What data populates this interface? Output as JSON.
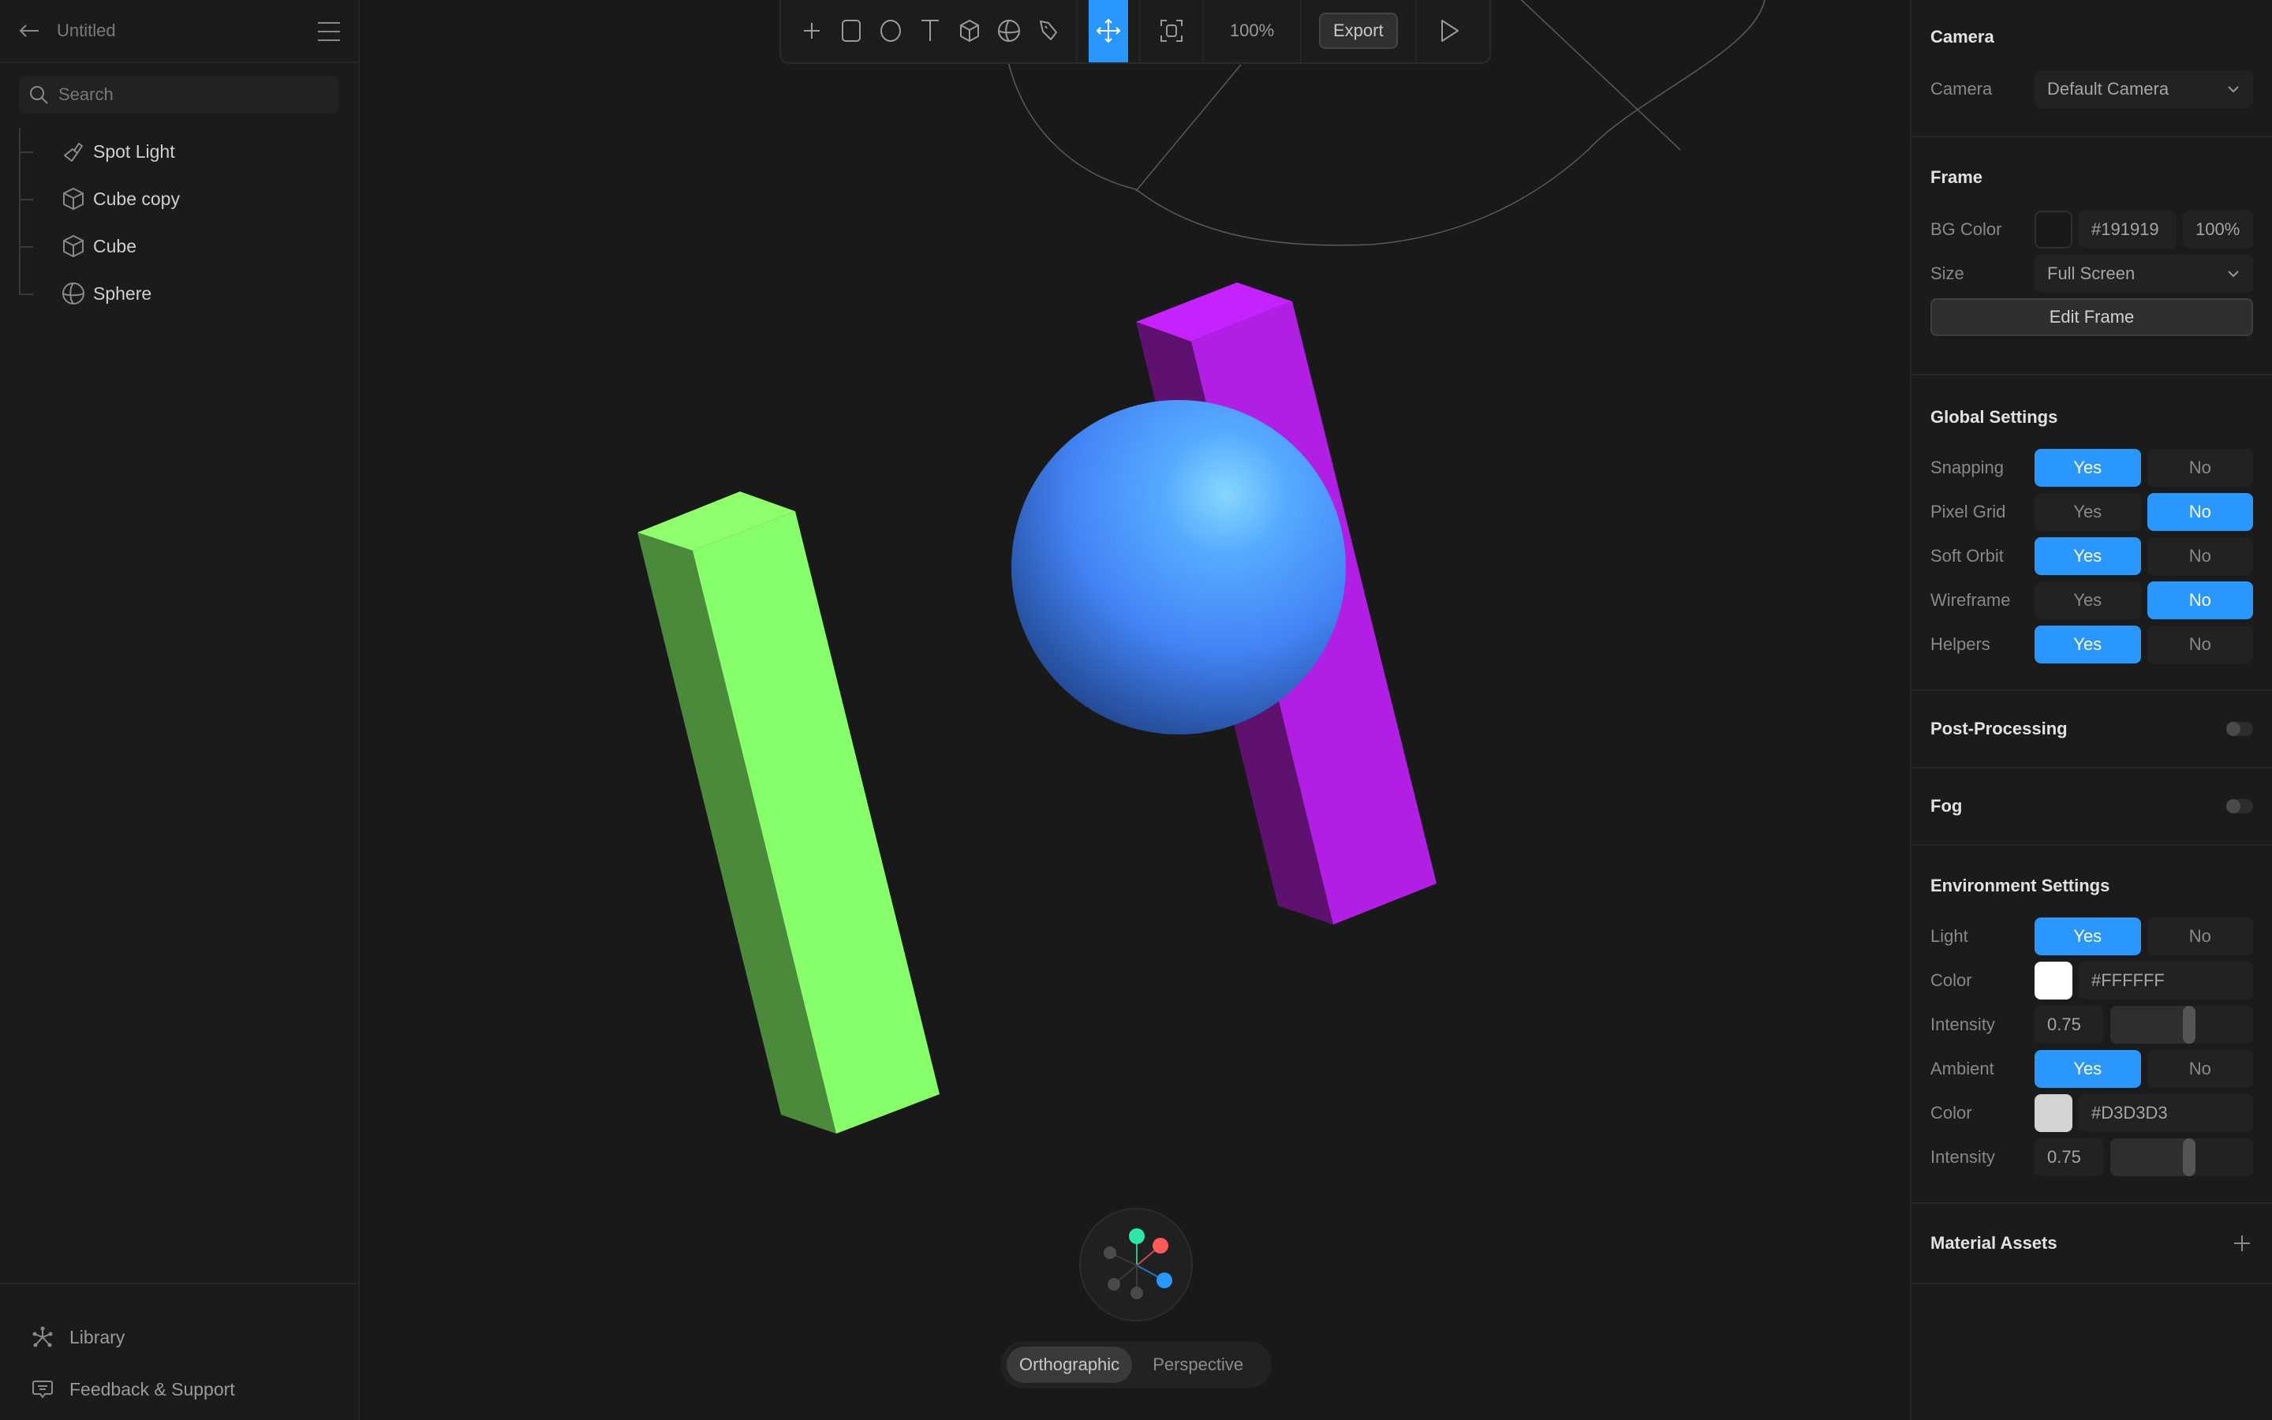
{
  "sidebar": {
    "title": "Untitled",
    "search_placeholder": "Search",
    "objects": [
      {
        "label": "Spot Light",
        "icon": "spotlight-icon"
      },
      {
        "label": "Cube copy",
        "icon": "cube-icon"
      },
      {
        "label": "Cube",
        "icon": "cube-icon"
      },
      {
        "label": "Sphere",
        "icon": "sphere-icon"
      }
    ],
    "footer": [
      {
        "label": "Library",
        "icon": "library-icon"
      },
      {
        "label": "Feedback & Support",
        "icon": "feedback-icon"
      }
    ]
  },
  "toolbar": {
    "tools": [
      "add",
      "rectangle",
      "ellipse",
      "text",
      "cube",
      "sphere",
      "pen"
    ],
    "active_tool": "move",
    "zoom": "100%",
    "export_label": "Export"
  },
  "viewport": {
    "projection_options": [
      "Orthographic",
      "Perspective"
    ],
    "active_projection": "Orthographic",
    "objects": [
      {
        "name": "Cube",
        "color": "#86FF6A"
      },
      {
        "name": "Cube copy",
        "color": "#C01FE8"
      },
      {
        "name": "Sphere",
        "color": "#4A8CFF"
      }
    ]
  },
  "panel": {
    "camera": {
      "title": "Camera",
      "label": "Camera",
      "value": "Default Camera"
    },
    "frame": {
      "title": "Frame",
      "bg_label": "BG Color",
      "bg_color": "#191919",
      "bg_opacity": "100%",
      "size_label": "Size",
      "size_value": "Full Screen",
      "edit_label": "Edit Frame"
    },
    "global": {
      "title": "Global Settings",
      "yes": "Yes",
      "no": "No",
      "rows": [
        {
          "label": "Snapping",
          "value": true
        },
        {
          "label": "Pixel Grid",
          "value": false
        },
        {
          "label": "Soft Orbit",
          "value": true
        },
        {
          "label": "Wireframe",
          "value": false
        },
        {
          "label": "Helpers",
          "value": true
        }
      ]
    },
    "post_processing": {
      "title": "Post-Processing",
      "enabled": false
    },
    "fog": {
      "title": "Fog",
      "enabled": false
    },
    "environment": {
      "title": "Environment Settings",
      "light_label": "Light",
      "light": true,
      "light_color_label": "Color",
      "light_color": "#FFFFFF",
      "light_intensity_label": "Intensity",
      "light_intensity": "0.75",
      "ambient_label": "Ambient",
      "ambient": true,
      "ambient_color_label": "Color",
      "ambient_color": "#D3D3D3",
      "ambient_intensity_label": "Intensity",
      "ambient_intensity": "0.75"
    },
    "materials": {
      "title": "Material Assets"
    }
  },
  "accent": "#2A97FF"
}
